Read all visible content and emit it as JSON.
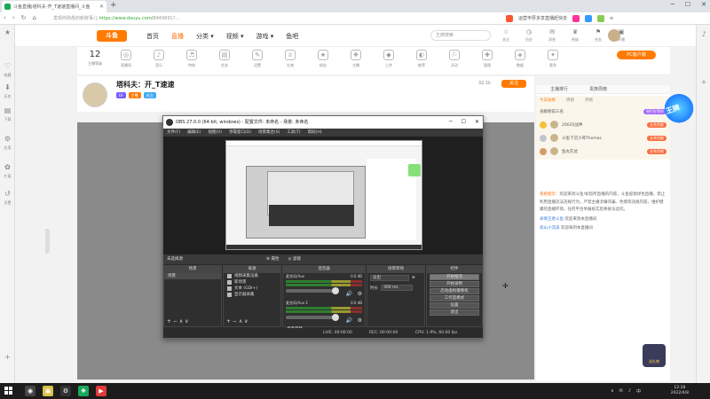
{
  "browser": {
    "tab_title": "斗鱼直播|塔科夫-开_T速速直播间_斗鱼",
    "url_prefix": "发现你熟悉的新鲜事儿",
    "url_domain": "https://www.douyu.com/",
    "url_rest": "9949691?...",
    "right_tools": [
      "运营丰厚多享直播赶快去",
      "拓展",
      "收藏",
      "设置"
    ],
    "window_controls": [
      "─",
      "☐",
      "✕"
    ],
    "left_sidebar": [
      "收藏",
      "历史",
      "下载",
      "应用",
      "扩展",
      "设置"
    ],
    "left_sidebar_icons": [
      "★",
      "♡",
      "⬇",
      "▤",
      "⚙",
      "✿",
      "↺",
      "+"
    ]
  },
  "header": {
    "logo": "斗鱼",
    "nav": [
      "首页",
      "直播",
      "分类 ▾",
      "视频 ▾",
      "游戏 ▾",
      "鱼吧"
    ],
    "active_nav": "直播",
    "search_placeholder": "王牌搜索",
    "icons": [
      {
        "icon": "☆",
        "label": "关注"
      },
      {
        "icon": "◷",
        "label": "历史"
      },
      {
        "icon": "✉",
        "label": "消息"
      },
      {
        "icon": "♛",
        "label": "贵族"
      },
      {
        "icon": "⚑",
        "label": "任务"
      },
      {
        "icon": "▣",
        "label": "开播"
      }
    ]
  },
  "toolbar": {
    "level_num": "12",
    "level_label": "主播等级",
    "tools": [
      {
        "icon": "◎",
        "label": "直播间"
      },
      {
        "icon": "♪",
        "label": "音乐"
      },
      {
        "icon": "♬",
        "label": "特效"
      },
      {
        "icon": "▤",
        "label": "任务"
      },
      {
        "icon": "✎",
        "label": "设置"
      },
      {
        "icon": "♕",
        "label": "礼物"
      },
      {
        "icon": "★",
        "label": "粉丝"
      },
      {
        "icon": "❖",
        "label": "主播"
      },
      {
        "icon": "◆",
        "label": "上传"
      },
      {
        "icon": "◐",
        "label": "推荐"
      },
      {
        "icon": "⚐",
        "label": "活动"
      },
      {
        "icon": "✚",
        "label": "管理"
      },
      {
        "icon": "◈",
        "label": "数据"
      },
      {
        "icon": "✦",
        "label": "更多"
      }
    ],
    "pc_button": "PC客户端"
  },
  "stream": {
    "title": "塔科夫：开_T速速",
    "badges": [
      "LV",
      "主播",
      "关注"
    ],
    "viewer_count": "32.1k",
    "subscribe_label": "关注"
  },
  "obs": {
    "title": "OBS 27.0.0 (64-bit, windows) - 配置文件: 未命名 - 场景: 未命名",
    "controls": [
      "─",
      "☐",
      "✕"
    ],
    "menu": [
      "文件(F)",
      "编辑(E)",
      "视图(V)",
      "停靠窗口(D)",
      "场景集合(S)",
      "工具(T)",
      "帮助(H)"
    ],
    "source_label": "未选择源",
    "mid_buttons": [
      "⚙ 属性",
      "◎ 滤镜"
    ],
    "scenes_header": "场景",
    "scenes": [
      "场景"
    ],
    "sources_header": "来源",
    "sources": [
      "视频采集设备",
      "新场景",
      "文本 (GDI+)",
      "显示器采集"
    ],
    "mixer_header": "混音器",
    "mixer": [
      {
        "name": "麦克风/Aux",
        "db": "0.0 dB"
      },
      {
        "name": "麦克风/Aux 2",
        "db": "0.0 dB"
      }
    ],
    "mixer_footer": "桌面音频",
    "transitions_header": "场景转场",
    "transition_name": "淡出",
    "duration_label": "时长",
    "duration_value": "300 ms",
    "controls_header": "控件",
    "control_buttons": [
      "开始推流",
      "开始录制",
      "启动虚拟摄像机",
      "工作室模式",
      "设置",
      "退出"
    ],
    "footer_icons": "+  −  ∧  ∨",
    "status": {
      "live": "LIVE: 00:00:00",
      "rec": "REC: 00:00:00",
      "cpu": "CPU: 1.9%, 60.00 fps"
    }
  },
  "chat": {
    "tabs": [
      "主播排行",
      "贵族周榜"
    ],
    "rank_tabs": [
      "今日总榜",
      "周榜",
      "月榜"
    ],
    "rank_title": "贡献榜前三名",
    "rank_tag": "他们在等你",
    "ranks": [
      {
        "name": "20035战神",
        "tag": "去充贡献"
      },
      {
        "name": "斗鱼下沉小哥Thomas",
        "tag": "去充贡献"
      },
      {
        "name": "鱼丸在此",
        "tag": "去充贡献"
      }
    ],
    "messages": [
      {
        "sys": "系统提示：",
        "text": "欢迎来到斗鱼!如您所直播的内容，斗鱼提倡绿色直播，禁止利用直播违法违规行为，严禁主播涉嫌诈骗、色情等违规内容，维护健康的直播环境，任何平台举报核实后将依法追究。"
      },
      {
        "nick": "表情王者斗鱼",
        "text": "欢迎来到本直播间"
      },
      {
        "nick": "高山小流溪",
        "text": "欢迎来到本直播间"
      }
    ],
    "mascot_text": "王牌",
    "gift_text": "送礼物"
  },
  "taskbar": {
    "apps": [
      "◉",
      "▣",
      "⚙",
      "❖",
      "▶"
    ],
    "time": "12:28",
    "date": "2022/4/8",
    "tray_icons": [
      "∧",
      "✉",
      "♪",
      "中"
    ]
  },
  "colors": {
    "accent": "#ff7a00",
    "obs_bg": "#2b2b2b",
    "video_bg": "#8a8a8a"
  }
}
